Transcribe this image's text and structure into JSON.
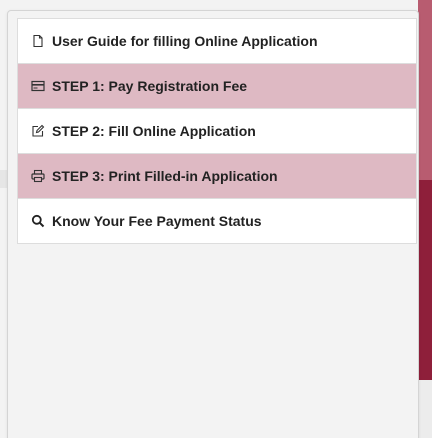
{
  "menu": {
    "items": [
      {
        "label": "User Guide for filling Online Application",
        "icon": "document-icon",
        "highlighted": false
      },
      {
        "label": "STEP 1: Pay Registration Fee",
        "icon": "credit-card-icon",
        "highlighted": true
      },
      {
        "label": "STEP 2: Fill Online Application",
        "icon": "edit-icon",
        "highlighted": false
      },
      {
        "label": "STEP 3: Print Filled-in Application",
        "icon": "printer-icon",
        "highlighted": true
      },
      {
        "label": "Know Your Fee Payment Status",
        "icon": "search-icon",
        "highlighted": false
      }
    ]
  },
  "colors": {
    "highlight": "#deb9c3",
    "accent_top": "#b85c70",
    "accent_mid": "#8e1f3a"
  }
}
